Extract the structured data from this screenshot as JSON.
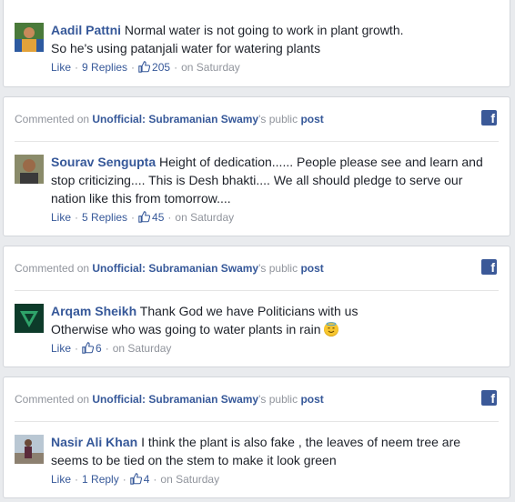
{
  "colors": {
    "link": "#365899",
    "muted": "#90949c",
    "text": "#1d2129",
    "fb_blue": "#3b5998"
  },
  "header": {
    "prefix": "Commented on",
    "page_name": "Unofficial: Subramanian Swamy",
    "possessive": "'s public",
    "post": "post",
    "fb_icon": "facebook-logo-icon"
  },
  "comments": [
    {
      "author": "Aadil Pattni",
      "text": "Normal water is not going to work in plant growth.",
      "text2": "So he's using patanjali water for watering plants",
      "like": "Like",
      "replies": "9 Replies",
      "likes": "205",
      "time": "on Saturday"
    },
    {
      "author": "Sourav Sengupta",
      "text": "Height of dedication...... People please see and learn and stop criticizing.... This is Desh bhakti.... We all should pledge to serve our nation like this from tomorrow....",
      "like": "Like",
      "replies": "5 Replies",
      "likes": "45",
      "time": "on Saturday"
    },
    {
      "author": "Arqam Sheikh",
      "text": "Thank God we have Politicians with us",
      "text2": "Otherwise who was going to water plants in rain",
      "emoji": "smiling-face-with-halo",
      "like": "Like",
      "likes": "6",
      "time": "on Saturday"
    },
    {
      "author": "Nasir Ali Khan",
      "text": "I think the plant is also fake , the leaves of neem tree are seems to be tied on the stem to make it look green",
      "like": "Like",
      "replies": "1 Reply",
      "likes": "4",
      "time": "on Saturday"
    }
  ]
}
